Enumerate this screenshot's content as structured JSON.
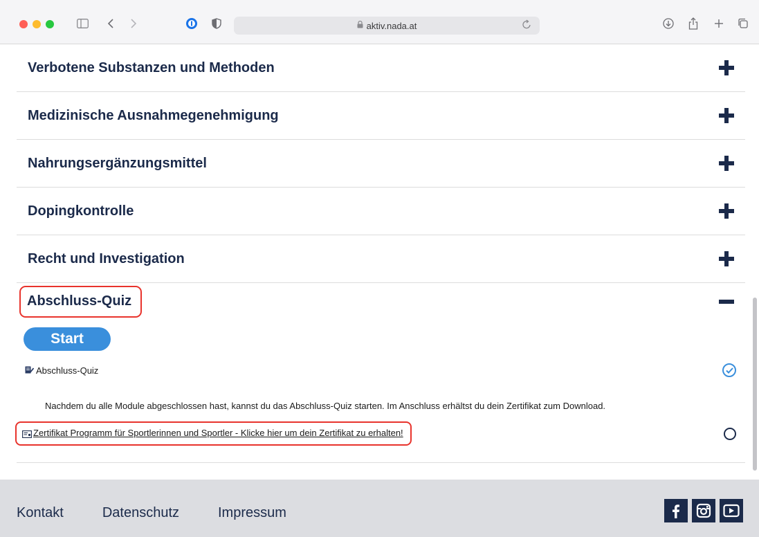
{
  "browser": {
    "url": "aktiv.nada.at"
  },
  "accordion": [
    {
      "title": "Verbotene Substanzen und Methoden",
      "state": "collapsed"
    },
    {
      "title": "Medizinische Ausnahmegenehmigung",
      "state": "collapsed"
    },
    {
      "title": "Nahrungsergänzungsmittel",
      "state": "collapsed"
    },
    {
      "title": "Dopingkontrolle",
      "state": "collapsed"
    },
    {
      "title": "Recht und Investigation",
      "state": "collapsed"
    }
  ],
  "quiz_section": {
    "title": "Abschluss-Quiz",
    "state": "expanded",
    "start_label": "Start",
    "quiz_item_label": "Abschluss-Quiz",
    "quiz_item_done": true,
    "description": "Nachdem du alle Module abgeschlossen hast, kannst du das Abschluss-Quiz starten. Im Anschluss erhältst du dein Zertifikat zum Download.",
    "certificate_link": "Zertifikat Programm für Sportlerinnen und Sportler - Klicke hier um dein Zertifikat zu erhalten!",
    "certificate_done": false
  },
  "footer": {
    "links": [
      "Kontakt",
      "Datenschutz",
      "Impressum"
    ],
    "social": [
      "facebook-icon",
      "instagram-icon",
      "youtube-icon"
    ]
  },
  "colors": {
    "navy": "#1b2a4a",
    "accent_blue": "#3a8fdc",
    "highlight_red": "#e8332c",
    "footer_bg": "#dcdde1"
  }
}
